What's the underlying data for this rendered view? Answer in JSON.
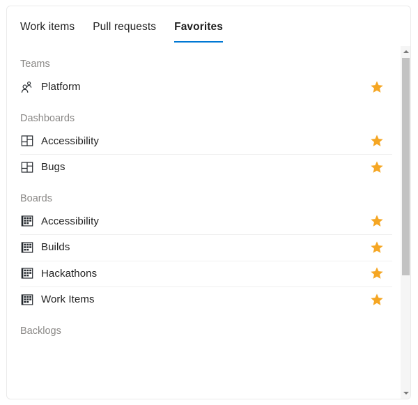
{
  "tabs": [
    {
      "label": "Work items",
      "active": false
    },
    {
      "label": "Pull requests",
      "active": false
    },
    {
      "label": "Favorites",
      "active": true
    }
  ],
  "accent_color": "#0078d4",
  "star_color": "#f5a623",
  "section_header_color": "#8a8886",
  "sections": [
    {
      "title": "Teams",
      "items": [
        {
          "label": "Platform",
          "icon": "people-icon",
          "favorited": true
        }
      ]
    },
    {
      "title": "Dashboards",
      "items": [
        {
          "label": "Accessibility",
          "icon": "dashboard-icon",
          "favorited": true
        },
        {
          "label": "Bugs",
          "icon": "dashboard-icon",
          "favorited": true
        }
      ]
    },
    {
      "title": "Boards",
      "items": [
        {
          "label": "Accessibility",
          "icon": "board-icon",
          "favorited": true
        },
        {
          "label": "Builds",
          "icon": "board-icon",
          "favorited": true
        },
        {
          "label": "Hackathons",
          "icon": "board-icon",
          "favorited": true
        },
        {
          "label": "Work Items",
          "icon": "board-icon",
          "favorited": true
        }
      ]
    },
    {
      "title": "Backlogs",
      "items": []
    }
  ],
  "scrollbar": {
    "up_arrow": "scroll-up-arrow",
    "down_arrow": "scroll-down-arrow",
    "thumb": "scroll-thumb"
  }
}
